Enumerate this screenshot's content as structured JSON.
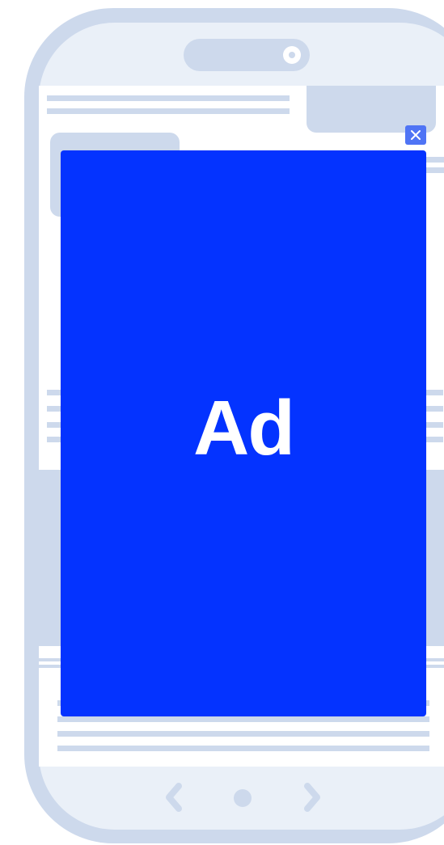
{
  "ad": {
    "label": "Ad",
    "background_color": "#0433ff",
    "text_color": "#ffffff"
  },
  "close_button": {
    "icon": "close-icon",
    "background_color": "#4f74f5"
  },
  "device": {
    "frame_color": "#cdd9ec",
    "bezel_color": "#eaf0f8"
  },
  "navigation": {
    "back_icon": "chevron-left-icon",
    "home_icon": "home-dot-icon",
    "forward_icon": "chevron-right-icon"
  }
}
